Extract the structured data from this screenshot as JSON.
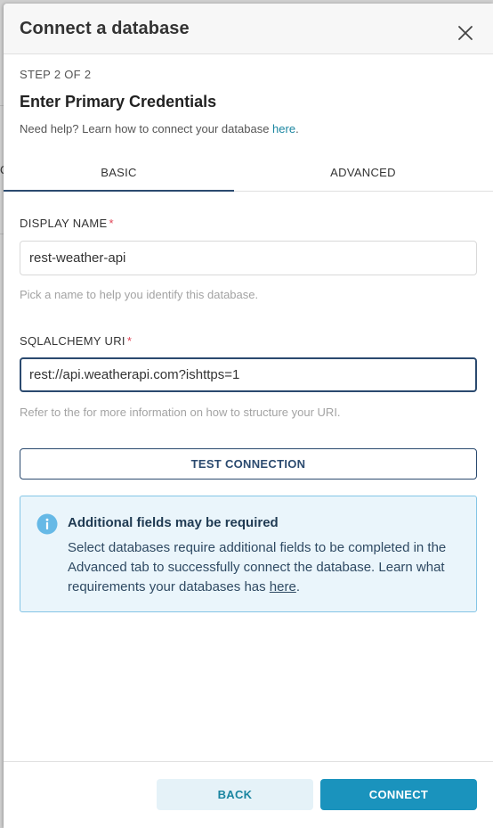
{
  "backdrop": {
    "fragment": "Q"
  },
  "modal": {
    "title": "Connect a database",
    "step": "STEP 2 OF 2",
    "subtitle": "Enter Primary Credentials",
    "help_prefix": "Need help? Learn how to connect your database ",
    "help_link": "here",
    "help_suffix": "."
  },
  "tabs": [
    {
      "label": "BASIC",
      "active": true
    },
    {
      "label": "ADVANCED",
      "active": false
    }
  ],
  "form": {
    "display_name": {
      "label": "DISPLAY NAME",
      "required_mark": "*",
      "value": "rest-weather-api",
      "hint": "Pick a name to help you identify this database."
    },
    "sqlalchemy_uri": {
      "label": "SQLALCHEMY URI",
      "required_mark": "*",
      "value": "rest://api.weatherapi.com?ishttps=1",
      "hint": "Refer to the for more information on how to structure your URI."
    },
    "test_button": "TEST CONNECTION"
  },
  "alert": {
    "icon": "info-icon",
    "title": "Additional fields may be required",
    "body": "Select databases require additional fields to be completed in the Advanced tab to successfully connect the database. Learn what requirements your databases has ",
    "link": "here",
    "link_suffix": "."
  },
  "footer": {
    "back": "BACK",
    "connect": "CONNECT"
  },
  "colors": {
    "primary": "#1a93bd",
    "dark_accent": "#2b4a6f",
    "required": "#e04355",
    "alert_bg": "#eaf5fb",
    "alert_border": "#84c5e6",
    "info_icon": "#66b9e6"
  }
}
